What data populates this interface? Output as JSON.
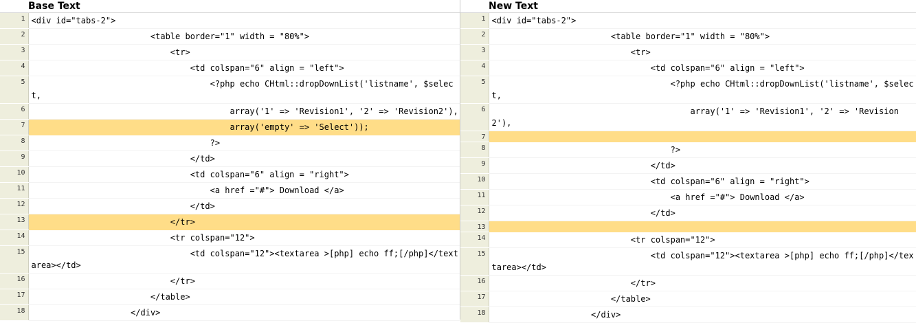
{
  "left": {
    "title": "Base Text",
    "lines": [
      {
        "num": "1",
        "text": "<div id=\"tabs-2\">",
        "changed": false
      },
      {
        "num": "2",
        "text": "                        <table border=\"1\" width = \"80%\">",
        "changed": false
      },
      {
        "num": "3",
        "text": "                            <tr>",
        "changed": false
      },
      {
        "num": "4",
        "text": "                                <td colspan=\"6\" align = \"left\">",
        "changed": false
      },
      {
        "num": "5",
        "text": "                                    <?php echo CHtml::dropDownList('listname', $select,",
        "changed": false
      },
      {
        "num": "6",
        "text": "                                        array('1' => 'Revision1', '2' => 'Revision2'),",
        "changed": false
      },
      {
        "num": "7",
        "text": "                                        array('empty' => 'Select'));",
        "changed": true
      },
      {
        "num": "8",
        "text": "                                    ?>",
        "changed": false
      },
      {
        "num": "9",
        "text": "                                </td>",
        "changed": false
      },
      {
        "num": "10",
        "text": "                                <td colspan=\"6\" align = \"right\">",
        "changed": false
      },
      {
        "num": "11",
        "text": "                                    <a href =\"#\"> Download </a>",
        "changed": false
      },
      {
        "num": "12",
        "text": "                                </td>",
        "changed": false
      },
      {
        "num": "13",
        "text": "                            </tr>",
        "changed": true
      },
      {
        "num": "14",
        "text": "                            <tr colspan=\"12\">",
        "changed": false
      },
      {
        "num": "15",
        "text": "                                <td colspan=\"12\"><textarea >[php] echo ff;[/php]</textarea></td>",
        "changed": false
      },
      {
        "num": "16",
        "text": "                            </tr>",
        "changed": false
      },
      {
        "num": "17",
        "text": "                        </table>",
        "changed": false
      },
      {
        "num": "18",
        "text": "                    </div>",
        "changed": false
      }
    ]
  },
  "right": {
    "title": "New Text",
    "lines": [
      {
        "num": "1",
        "text": "<div id=\"tabs-2\">",
        "changed": false
      },
      {
        "num": "2",
        "text": "                        <table border=\"1\" width = \"80%\">",
        "changed": false
      },
      {
        "num": "3",
        "text": "                            <tr>",
        "changed": false
      },
      {
        "num": "4",
        "text": "                                <td colspan=\"6\" align = \"left\">",
        "changed": false
      },
      {
        "num": "5",
        "text": "                                    <?php echo CHtml::dropDownList('listname', $select,",
        "changed": false
      },
      {
        "num": "6",
        "text": "                                        array('1' => 'Revision1', '2' => 'Revision2'),",
        "changed": false
      },
      {
        "num": "7",
        "text": "",
        "changed": true
      },
      {
        "num": "8",
        "text": "                                    ?>",
        "changed": false
      },
      {
        "num": "9",
        "text": "                                </td>",
        "changed": false
      },
      {
        "num": "10",
        "text": "                                <td colspan=\"6\" align = \"right\">",
        "changed": false
      },
      {
        "num": "11",
        "text": "                                    <a href =\"#\"> Download </a>",
        "changed": false
      },
      {
        "num": "12",
        "text": "                                </td>",
        "changed": false
      },
      {
        "num": "13",
        "text": "",
        "changed": true
      },
      {
        "num": "14",
        "text": "                            <tr colspan=\"12\">",
        "changed": false
      },
      {
        "num": "15",
        "text": "                                <td colspan=\"12\"><textarea >[php] echo ff;[/php]</textarea></td>",
        "changed": false
      },
      {
        "num": "16",
        "text": "                            </tr>",
        "changed": false
      },
      {
        "num": "17",
        "text": "                        </table>",
        "changed": false
      },
      {
        "num": "18",
        "text": "                    </div>",
        "changed": false
      }
    ]
  },
  "colors": {
    "changed_bg": "#ffdd88",
    "gutter_bg": "#eeeedd"
  }
}
